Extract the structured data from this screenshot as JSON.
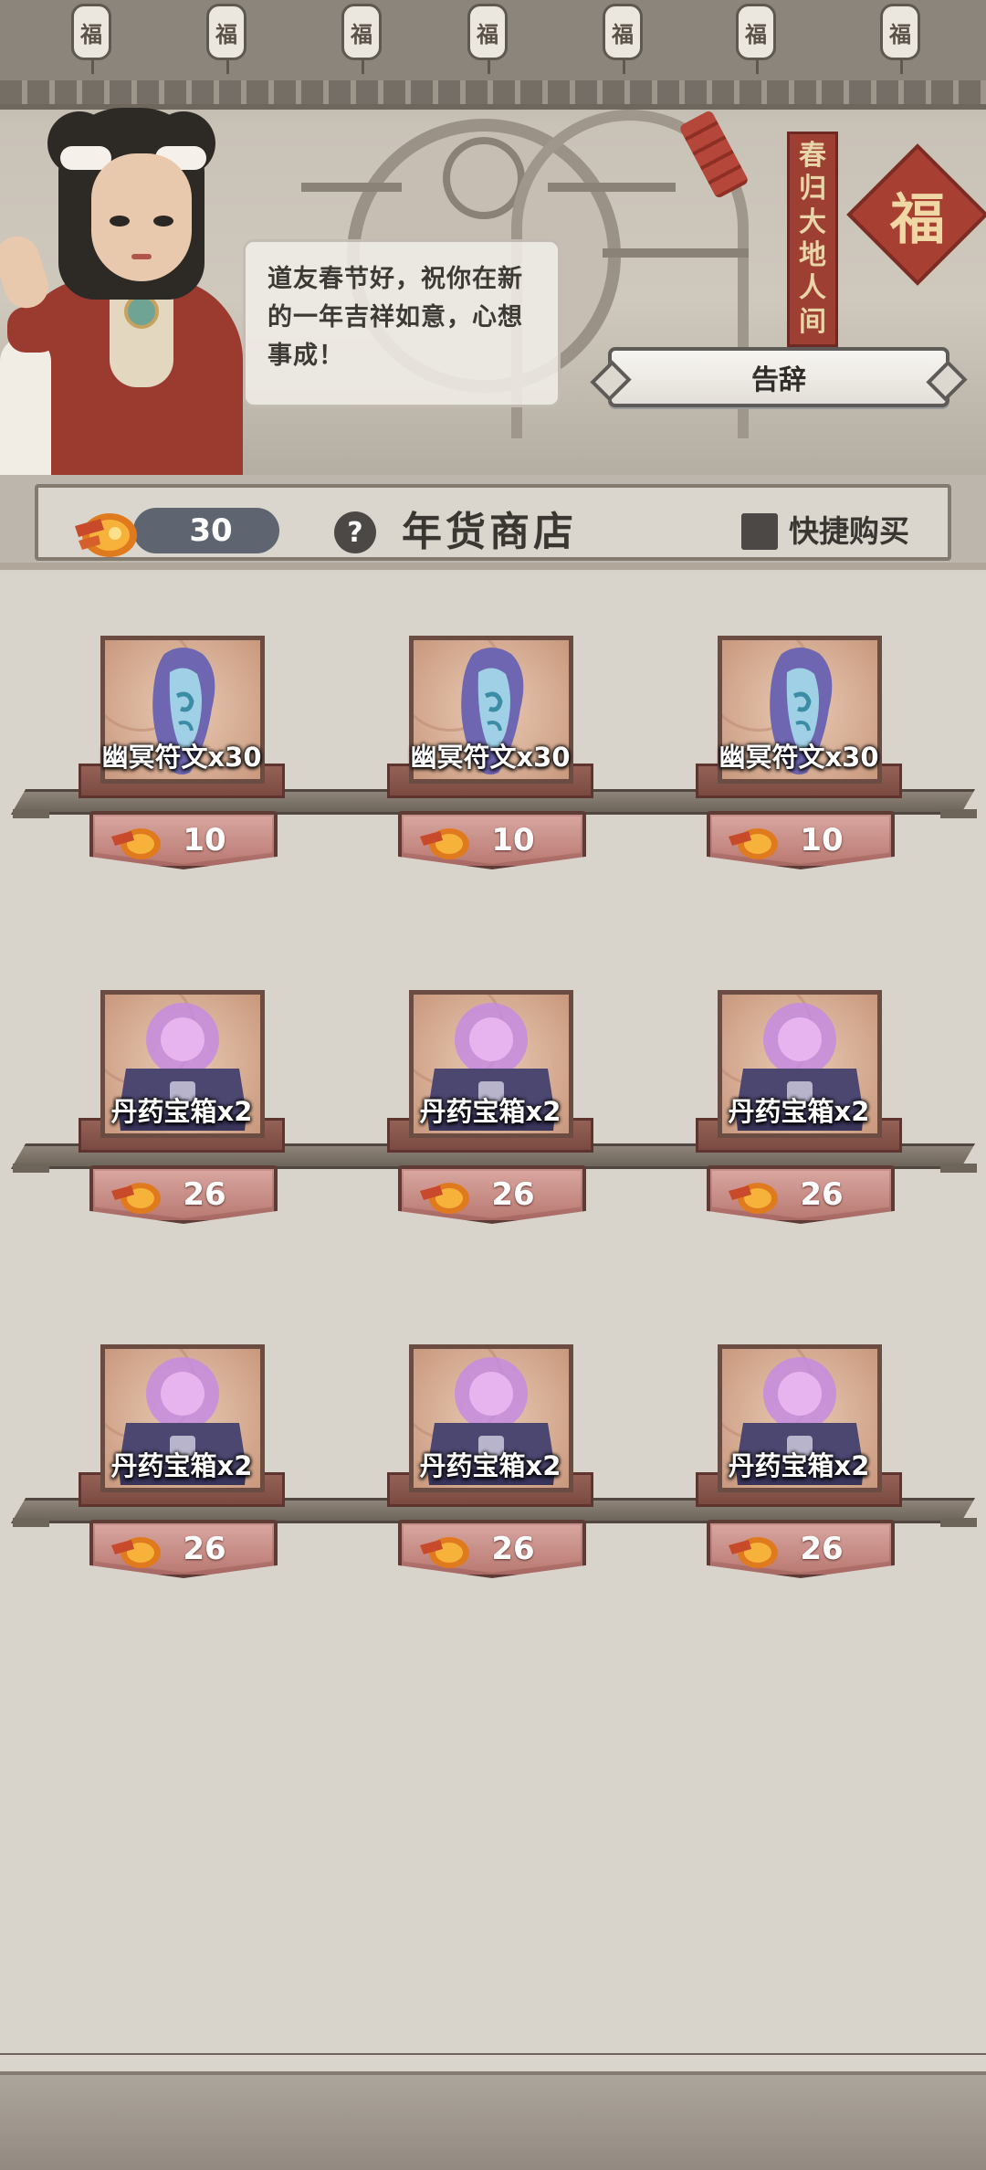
{
  "scene": {
    "lanterns": [
      "福",
      "福",
      "福",
      "福",
      "福",
      "福",
      "福"
    ],
    "scroll_text": [
      "春",
      "归",
      "大",
      "地",
      "人",
      "间"
    ],
    "fu": "福"
  },
  "dialog": {
    "text_line1": "道友春节好，祝你在新",
    "text_line2": "的一年吉祥如意，心想",
    "text_line3": "事成！",
    "farewell_label": "告辞"
  },
  "header": {
    "currency_amount": "30",
    "help_label": "?",
    "title": "年货商店",
    "quick_buy_label": "快捷购买",
    "quick_buy_checked": false
  },
  "rows": [
    {
      "items": [
        {
          "name": "幽冥符文x30",
          "price": "10",
          "icon": "rune-icon"
        },
        {
          "name": "幽冥符文x30",
          "price": "10",
          "icon": "rune-icon"
        },
        {
          "name": "幽冥符文x30",
          "price": "10",
          "icon": "rune-icon"
        }
      ]
    },
    {
      "items": [
        {
          "name": "丹药宝箱x2",
          "price": "26",
          "icon": "chest-icon"
        },
        {
          "name": "丹药宝箱x2",
          "price": "26",
          "icon": "chest-icon"
        },
        {
          "name": "丹药宝箱x2",
          "price": "26",
          "icon": "chest-icon"
        }
      ]
    },
    {
      "items": [
        {
          "name": "丹药宝箱x2",
          "price": "26",
          "icon": "chest-icon"
        },
        {
          "name": "丹药宝箱x2",
          "price": "26",
          "icon": "chest-icon"
        },
        {
          "name": "丹药宝箱x2",
          "price": "26",
          "icon": "chest-icon"
        }
      ]
    }
  ],
  "colors": {
    "accent_red": "#9b3b30",
    "price_tag": "#b97a73",
    "pill": "#5e6570"
  }
}
